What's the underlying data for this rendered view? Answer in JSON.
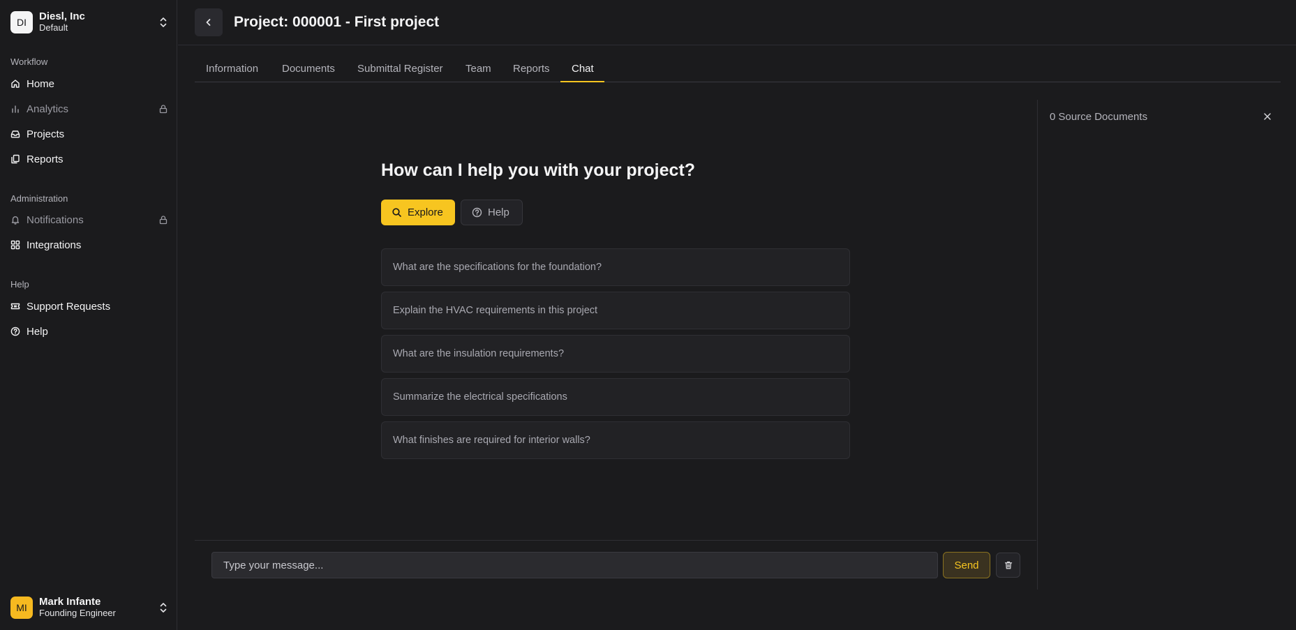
{
  "org": {
    "initials": "DI",
    "name": "Diesl, Inc",
    "workspace": "Default"
  },
  "sidebar": {
    "sections": [
      {
        "label": "Workflow"
      },
      {
        "label": "Administration"
      },
      {
        "label": "Help"
      }
    ],
    "items": [
      {
        "label": "Home",
        "icon": "home-icon",
        "locked": false
      },
      {
        "label": "Analytics",
        "icon": "bar-chart-icon",
        "locked": true
      },
      {
        "label": "Projects",
        "icon": "inbox-icon",
        "locked": false
      },
      {
        "label": "Reports",
        "icon": "files-icon",
        "locked": false
      },
      {
        "label": "Notifications",
        "icon": "bell-icon",
        "locked": true
      },
      {
        "label": "Integrations",
        "icon": "grid-icon",
        "locked": false
      },
      {
        "label": "Support Requests",
        "icon": "ticket-icon",
        "locked": false
      },
      {
        "label": "Help",
        "icon": "help-circle-icon",
        "locked": false
      }
    ]
  },
  "user": {
    "initials": "MI",
    "name": "Mark Infante",
    "role": "Founding Engineer"
  },
  "header": {
    "title": "Project: 000001 - First project"
  },
  "tabs": [
    {
      "label": "Information",
      "active": false
    },
    {
      "label": "Documents",
      "active": false
    },
    {
      "label": "Submittal Register",
      "active": false
    },
    {
      "label": "Team",
      "active": false
    },
    {
      "label": "Reports",
      "active": false
    },
    {
      "label": "Chat",
      "active": true
    }
  ],
  "chat": {
    "heading": "How can I help you with your project?",
    "modes": {
      "explore": "Explore",
      "help": "Help"
    },
    "suggestions": [
      "What are the specifications for the foundation?",
      "Explain the HVAC requirements in this project",
      "What are the insulation requirements?",
      "Summarize the electrical specifications",
      "What finishes are required for interior walls?"
    ],
    "input_placeholder": "Type your message...",
    "send_label": "Send"
  },
  "source_panel": {
    "title": "0 Source Documents"
  },
  "colors": {
    "accent": "#f7c520",
    "background": "#1b1b1d",
    "surface": "#222225"
  }
}
